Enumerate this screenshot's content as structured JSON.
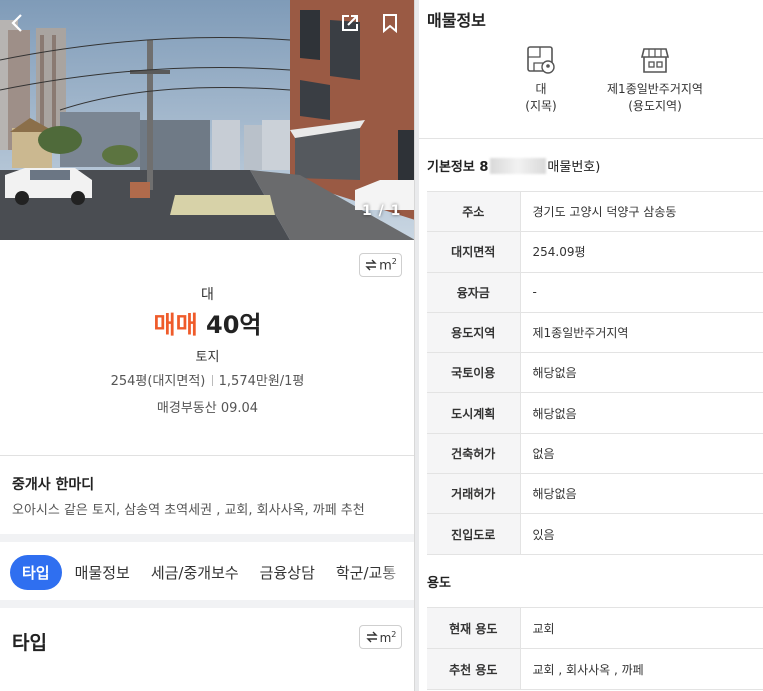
{
  "photo": {
    "counter": "1 / 1"
  },
  "unit_toggle": {
    "label": "m",
    "sup": "2"
  },
  "summary": {
    "land_type": "대",
    "deal_type": "매매",
    "price": "40억",
    "category": "토지",
    "area": "254평(대지면적)",
    "unit_price": "1,574만원/1평",
    "agency": "매경부동산 09.04"
  },
  "comment": {
    "title": "중개사 한마디",
    "text": "오아시스 같은 토지, 삼송역 초역세권 , 교회, 회사사옥, 까페 추천"
  },
  "tabs": [
    {
      "label": "타입",
      "active": true
    },
    {
      "label": "매물정보"
    },
    {
      "label": "세금/중개보수"
    },
    {
      "label": "금융상담"
    },
    {
      "label": "학군/교통"
    }
  ],
  "type_heading": "타입",
  "listing_info": {
    "title": "매물정보",
    "land": {
      "value": "대",
      "caption": "(지목)",
      "icon": "map-pin-icon"
    },
    "zone": {
      "value": "제1종일반주거지역",
      "caption": "(용도지역)",
      "icon": "shop-icon"
    }
  },
  "basic_info": {
    "title_prefix": "기본정보 8",
    "title_suffix": "매물번호)",
    "rows": [
      {
        "key": "주소",
        "value": "경기도 고양시 덕양구 삼송동"
      },
      {
        "key": "대지면적",
        "value": "254.09평"
      },
      {
        "key": "융자금",
        "value": "-"
      },
      {
        "key": "용도지역",
        "value": "제1종일반주거지역"
      },
      {
        "key": "국토이용",
        "value": "해당없음"
      },
      {
        "key": "도시계획",
        "value": "해당없음"
      },
      {
        "key": "건축허가",
        "value": "없음"
      },
      {
        "key": "거래허가",
        "value": "해당없음"
      },
      {
        "key": "진입도로",
        "value": "있음"
      }
    ]
  },
  "usage": {
    "title": "용도",
    "rows": [
      {
        "key": "현재 용도",
        "value": "교회"
      },
      {
        "key": "추천 용도",
        "value": "교회 , 회사사옥 , 까페"
      }
    ]
  },
  "colors": {
    "accent_blue": "#2f6ff0",
    "deal_orange": "#ef5b2a"
  }
}
